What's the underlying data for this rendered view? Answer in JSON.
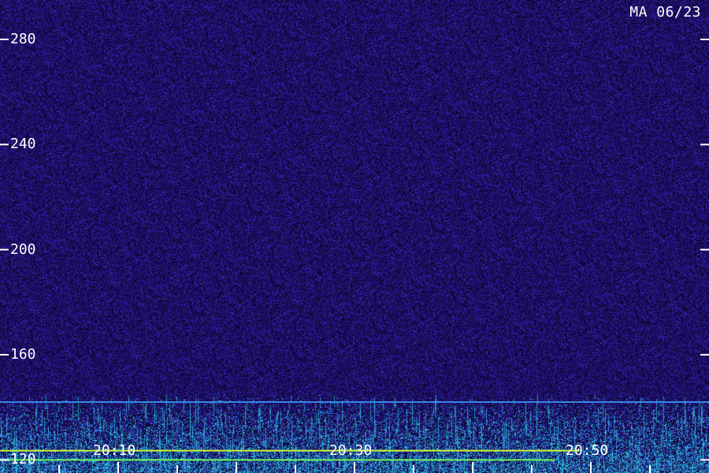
{
  "chart_data": {
    "type": "heatmap",
    "title": "MA 06/23",
    "y_ticks": [
      120,
      160,
      200,
      240,
      280
    ],
    "x_ticks": [
      "20:10",
      "20:30",
      "20:50"
    ],
    "ylim": [
      115,
      295
    ],
    "xlim_minutes": [
      0,
      60
    ],
    "x_tick_minutes": [
      10,
      30,
      50
    ],
    "x_minor_step_minutes": 5,
    "grid": false,
    "palette": {
      "background": "#1d0f63",
      "speckle_dark": "#0a0328",
      "speckle_light": "#3a2ab8",
      "band_blue": "#3a7ae8",
      "band_cyan": "#2fd6e8",
      "band_green": "#80ff40",
      "band_yellow": "#d8ff30",
      "text": "#ffffff"
    },
    "bands": [
      {
        "y": 142,
        "x_end": 60,
        "color": "#3a8ef0"
      },
      {
        "y": 123.5,
        "x_end": 49,
        "color": "#d8ff30"
      },
      {
        "y": 120,
        "x_end": 47,
        "color": "#70ff60"
      }
    ]
  }
}
